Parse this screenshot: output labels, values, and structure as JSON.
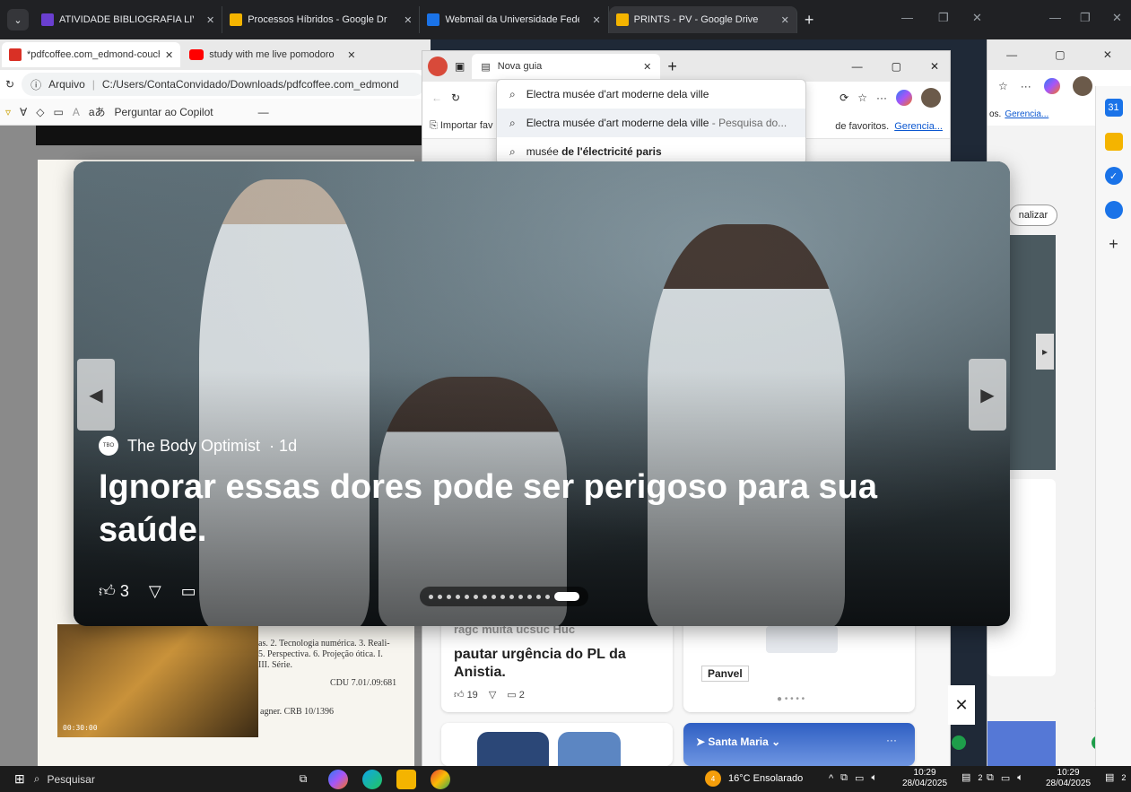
{
  "top_bar": {
    "tabs": [
      {
        "label": "ATIVIDADE BIBLIOGRAFIA LIVR",
        "color": "#6a3fd0"
      },
      {
        "label": "Processos Híbridos - Google Dr",
        "color": "#1e8e3e"
      },
      {
        "label": "Webmail da Universidade Feder",
        "color": "#1a73e8"
      },
      {
        "label": "PRINTS - PV - Google Drive",
        "color": "#1e8e3e"
      }
    ]
  },
  "left_window": {
    "tabs": [
      {
        "label": "*pdfcoffee.com_edmond-couchot"
      },
      {
        "label": "study with me live pomodoro"
      }
    ],
    "address_prefix": "Arquivo",
    "address": "C:/Users/ContaConvidado/Downloads/pdfcoffee.com_edmond",
    "pdf_toolbar_copilot": "Perguntar ao Copilot",
    "pdf_toolbar_read": "aあ",
    "paper_lines": [
      "as. 2. Tecnologia numérica. 3. Reali-",
      "5. Perspectiva. 6. Projeção ótica. I.",
      "III. Série."
    ],
    "paper_cdu": "CDU 7.01/.09:681",
    "paper_crb": "agner. CRB 10/1396",
    "photo_timestamp": "00:30:00"
  },
  "mid_window": {
    "tab_label": "Nova guia",
    "favbar_import": "Importar fav",
    "favbar_text": "de favoritos.",
    "favbar_link": "Gerencia...",
    "suggestions": [
      {
        "text": "Electra musée d'art moderne dela ville",
        "suffix": ""
      },
      {
        "text": "Electra musée d'art moderne dela ville",
        "suffix": " - Pesquisa do..."
      },
      {
        "prefix": "musée ",
        "bold": "de l'électricité paris"
      }
    ]
  },
  "right_window": {
    "favbar_text": "os.",
    "favbar_link": "Gerencia...",
    "personalize_label": "nalizar"
  },
  "feed": {
    "news_title": "pautar urgência do PL da Anistia.",
    "news_title_partial": "ragc muita ucsuc Huc",
    "news_likes": "19",
    "news_comments": "2",
    "ad_brand": "Panvel",
    "weather_location": "Santa Maria"
  },
  "hero": {
    "source": "The Body Optimist",
    "age": "· 1d",
    "title": "Ignorar essas dores pode ser perigoso para sua saúde.",
    "likes": "3",
    "dots": 15,
    "active_dot": 15
  },
  "taskbar": {
    "search_placeholder": "Pesquisar",
    "weather": "16°C  Ensolarado",
    "weather_badge": "4",
    "time": "10:29",
    "date": "28/04/2025",
    "notif_count": "2"
  }
}
